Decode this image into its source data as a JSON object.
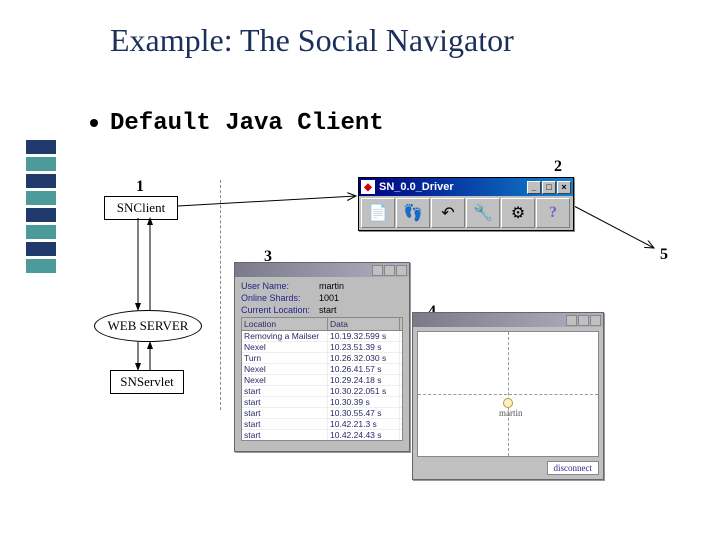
{
  "title": "Example: The Social Navigator",
  "bullet": "Default Java Client",
  "labels": {
    "n1": "1",
    "n2": "2",
    "n3": "3",
    "n4": "4",
    "n5": "5"
  },
  "snclient": "SNClient",
  "webserver": "WEB SERVER",
  "snservlet": "SNServlet",
  "win2": {
    "title": "SN_0.0_Driver",
    "btn_min": "_",
    "btn_max": "□",
    "btn_close": "×",
    "icons": {
      "doc": "doc-icon",
      "foot": "footprints-icon",
      "back": "back-icon",
      "tool": "wrench-icon",
      "gear": "gear-icon",
      "help": "help-icon"
    }
  },
  "win3": {
    "user_lbl": "User Name:",
    "user_val": "martin",
    "shards_lbl": "Online Shards:",
    "shards_val": "1001",
    "loc_lbl": "Current Location:",
    "loc_val": "start",
    "col1": "Location",
    "col2": "Data",
    "rows": [
      {
        "loc": "Removing a Mailser",
        "d": "10.19.32.599 s"
      },
      {
        "loc": "Nexel",
        "d": "10.23.51.39 s"
      },
      {
        "loc": "Turn",
        "d": "10.26.32.030 s"
      },
      {
        "loc": "Nexel",
        "d": "10.26.41.57 s"
      },
      {
        "loc": "Nexel",
        "d": "10.29.24.18 s"
      },
      {
        "loc": "start",
        "d": "10.30.22.051 s"
      },
      {
        "loc": "start",
        "d": "10.30.39 s"
      },
      {
        "loc": "start",
        "d": "10.30.55.47 s"
      },
      {
        "loc": "start",
        "d": "10.42.21.3 s"
      },
      {
        "loc": "start",
        "d": "10.42.24.43 s"
      }
    ]
  },
  "win5": {
    "person_label": "martin",
    "footer_tag": "disconnect"
  }
}
